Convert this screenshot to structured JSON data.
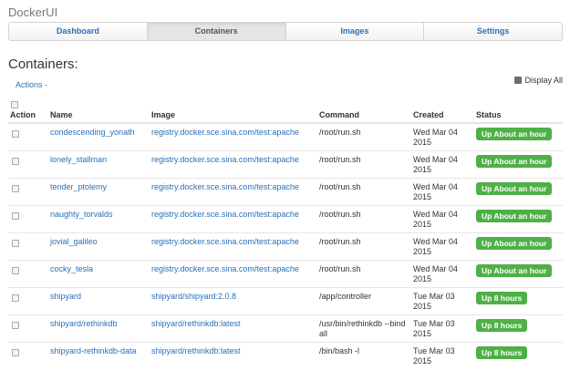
{
  "app": {
    "brand": "DockerUI"
  },
  "nav": [
    {
      "label": "Dashboard",
      "active": false
    },
    {
      "label": "Containers",
      "active": true
    },
    {
      "label": "Images",
      "active": false
    },
    {
      "label": "Settings",
      "active": false
    }
  ],
  "page": {
    "title": "Containers:",
    "actions_label": "Actions -",
    "display_all_label": "Display All",
    "display_all_checked": true
  },
  "table": {
    "headers": [
      "Action",
      "Name",
      "Image",
      "Command",
      "Created",
      "Status"
    ],
    "rows": [
      {
        "name": "condescending_yonath",
        "image": "registry.docker.sce.sina.com/test:apache",
        "command": "/root/run.sh",
        "created_l1": "Wed Mar 04",
        "created_l2": "2015",
        "status": "Up About an hour"
      },
      {
        "name": "lonely_stallman",
        "image": "registry.docker.sce.sina.com/test:apache",
        "command": "/root/run.sh",
        "created_l1": "Wed Mar 04",
        "created_l2": "2015",
        "status": "Up About an hour"
      },
      {
        "name": "tender_ptolemy",
        "image": "registry.docker.sce.sina.com/test:apache",
        "command": "/root/run.sh",
        "created_l1": "Wed Mar 04",
        "created_l2": "2015",
        "status": "Up About an hour"
      },
      {
        "name": "naughty_torvalds",
        "image": "registry.docker.sce.sina.com/test:apache",
        "command": "/root/run.sh",
        "created_l1": "Wed Mar 04",
        "created_l2": "2015",
        "status": "Up About an hour"
      },
      {
        "name": "jovial_galileo",
        "image": "registry.docker.sce.sina.com/test:apache",
        "command": "/root/run.sh",
        "created_l1": "Wed Mar 04",
        "created_l2": "2015",
        "status": "Up About an hour"
      },
      {
        "name": "cocky_tesla",
        "image": "registry.docker.sce.sina.com/test:apache",
        "command": "/root/run.sh",
        "created_l1": "Wed Mar 04",
        "created_l2": "2015",
        "status": "Up About an hour"
      },
      {
        "name": "shipyard",
        "image": "shipyard/shipyard:2.0.8",
        "command": "/app/controller",
        "created_l1": "Tue Mar 03",
        "created_l2": "2015",
        "status": "Up 8 hours"
      },
      {
        "name": "shipyard/rethinkdb",
        "image": "shipyard/rethinkdb:latest",
        "command": "/usr/bin/rethinkdb --bind all",
        "created_l1": "Tue Mar 03",
        "created_l2": "2015",
        "status": "Up 8 hours"
      },
      {
        "name": "shipyard-rethinkdb-data",
        "image": "shipyard/rethinkdb:latest",
        "command": "/bin/bash -l",
        "created_l1": "Tue Mar 03",
        "created_l2": "2015",
        "status": "Up 8 hours"
      }
    ]
  },
  "colors": {
    "link": "#2a6fb8",
    "status_green": "#4fb048"
  }
}
